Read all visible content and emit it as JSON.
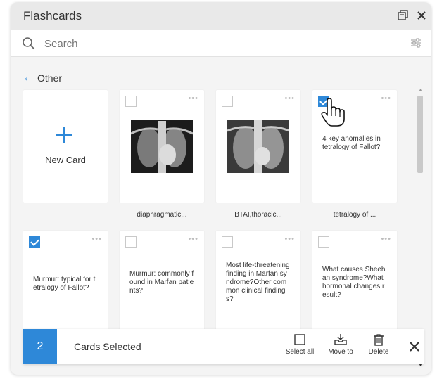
{
  "window": {
    "title": "Flashcards",
    "controls": {
      "restore_icon": "restore-window-icon",
      "close_icon": "close-icon"
    }
  },
  "search": {
    "placeholder": "Search",
    "value": ""
  },
  "breadcrumb": {
    "label": "Other"
  },
  "colors": {
    "accent": "#2e88d8",
    "background": "#f4f4f4",
    "card": "#ffffff"
  },
  "cards": [
    {
      "type": "new",
      "label": "New Card"
    },
    {
      "type": "image",
      "caption": "diaphragmatic...",
      "checked": false
    },
    {
      "type": "image",
      "caption": "BTAI,thoracic...",
      "checked": false
    },
    {
      "type": "text",
      "text": "4 key anomalies in tetralogy of Fallot?",
      "caption": "tetralogy of ...",
      "checked": true
    },
    {
      "type": "text",
      "text": "Murmur: typical for t etralogy of Fallot?",
      "checked": true
    },
    {
      "type": "text",
      "text": "Murmur: commonly f ound in Marfan patie nts?",
      "checked": false
    },
    {
      "type": "text",
      "text": "Most life-threatening finding in Marfan sy ndrome?Other com mon clinical finding s?",
      "checked": false
    },
    {
      "type": "text",
      "text": "What causes Sheeh an syndrome?What hormonal changes r esult?",
      "checked": false
    }
  ],
  "more_label": "•••",
  "selection": {
    "count": "2",
    "label": "Cards Selected",
    "actions": {
      "select_all": "Select all",
      "move_to": "Move to",
      "delete": "Delete"
    }
  }
}
